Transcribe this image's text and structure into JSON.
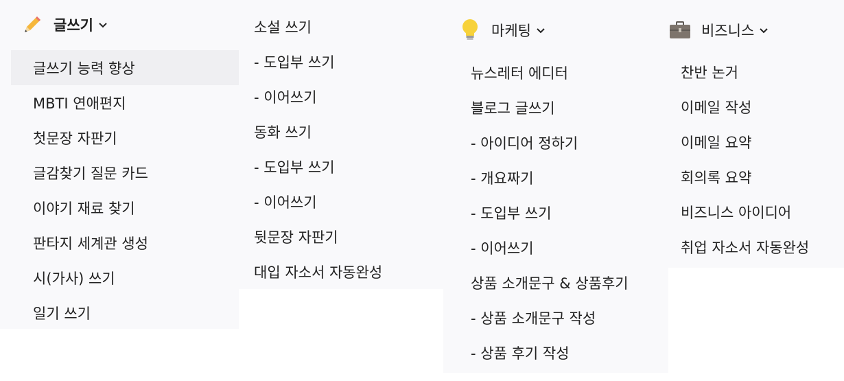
{
  "menus": [
    {
      "header": "글쓰기",
      "icon": "pencil-icon",
      "items": [
        "글쓰기 능력 향상",
        "MBTI 연애편지",
        "첫문장 자판기",
        "글감찾기 질문 카드",
        "이야기 재료 찾기",
        "판타지 세계관 생성",
        "시(가사) 쓰기",
        "일기 쓰기"
      ]
    },
    {
      "items": [
        "소설 쓰기",
        "- 도입부 쓰기",
        "- 이어쓰기",
        "동화 쓰기",
        "- 도입부 쓰기",
        "- 이어쓰기",
        "뒷문장 자판기",
        "대입 자소서 자동완성"
      ]
    },
    {
      "header": "마케팅",
      "icon": "lightbulb-icon",
      "items": [
        "뉴스레터 에디터",
        "블로그 글쓰기",
        "- 아이디어 정하기",
        "- 개요짜기",
        "- 도입부 쓰기",
        "- 이어쓰기",
        "상품 소개문구 & 상품후기",
        "- 상품 소개문구 작성",
        "- 상품 후기 작성"
      ]
    },
    {
      "header": "비즈니스",
      "icon": "briefcase-icon",
      "items": [
        "찬반 논거",
        "이메일 작성",
        "이메일 요약",
        "회의록 요약",
        "비즈니스 아이디어",
        "취업 자소서 자동완성"
      ]
    }
  ],
  "active_item": "글쓰기 능력 향상",
  "colors": {
    "panel_bg": "#f9f9fb",
    "hover_bg": "#efeff2",
    "text": "#222222",
    "bulb": "#f7d23a"
  }
}
